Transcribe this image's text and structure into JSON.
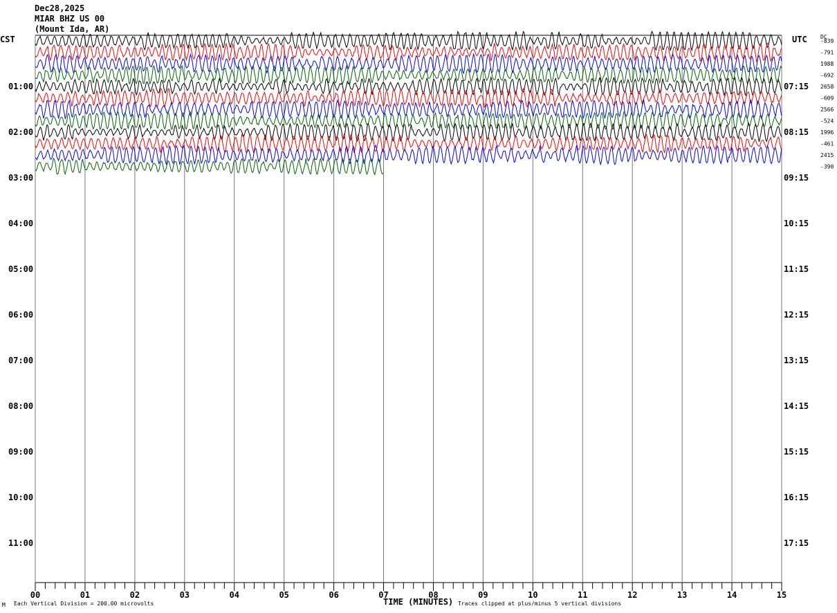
{
  "header": {
    "date": "Dec28,2025",
    "station": "MIAR BHZ US 00",
    "location": "(Mount Ida, AR)"
  },
  "left_timezone": "CST",
  "right_timezone": "UTC",
  "dc_label": "DC",
  "footer": {
    "scale_note": "Each Vertical Division =  200.00 microvolts",
    "xlabel": "TIME (MINUTES)",
    "clip_note": "Traces clipped at plus/minus 5 vertical divisions"
  },
  "chart_data": {
    "type": "line",
    "title": "Dec28,2025 MIAR BHZ US 00 (Mount Ida, AR)",
    "xlabel": "TIME (MINUTES)",
    "xlim": [
      0,
      15
    ],
    "x_ticks": [
      "00",
      "01",
      "02",
      "03",
      "04",
      "05",
      "06",
      "07",
      "08",
      "09",
      "10",
      "11",
      "12",
      "13",
      "14",
      "15"
    ],
    "minutes_per_line": 15,
    "left_hour_labels": [
      "01:00",
      "02:00",
      "03:00",
      "04:00",
      "05:00",
      "06:00",
      "07:00",
      "08:00",
      "09:00",
      "10:00",
      "11:00"
    ],
    "right_hour_labels": [
      "07:15",
      "08:15",
      "09:15",
      "10:15",
      "11:15",
      "12:15",
      "13:15",
      "14:15",
      "15:15",
      "16:15",
      "17:15"
    ],
    "trace_colors": [
      "#000000",
      "#ff0000",
      "#0000ff",
      "#006400"
    ],
    "grid": true,
    "traces": [
      {
        "start": "00:00",
        "dc": "-839",
        "minutes": 15
      },
      {
        "start": "00:15",
        "dc": "-791",
        "minutes": 15
      },
      {
        "start": "00:30",
        "dc": "1988",
        "minutes": 15
      },
      {
        "start": "00:45",
        "dc": "-692",
        "minutes": 15
      },
      {
        "start": "01:00",
        "dc": "2658",
        "minutes": 15
      },
      {
        "start": "01:15",
        "dc": "-609",
        "minutes": 15
      },
      {
        "start": "01:30",
        "dc": "2566",
        "minutes": 15
      },
      {
        "start": "01:45",
        "dc": "-524",
        "minutes": 15
      },
      {
        "start": "02:00",
        "dc": "1996",
        "minutes": 15
      },
      {
        "start": "02:15",
        "dc": "-461",
        "minutes": 15
      },
      {
        "start": "02:30",
        "dc": "2415",
        "minutes": 15
      },
      {
        "start": "02:45",
        "dc": "-390",
        "minutes": 7
      }
    ]
  }
}
